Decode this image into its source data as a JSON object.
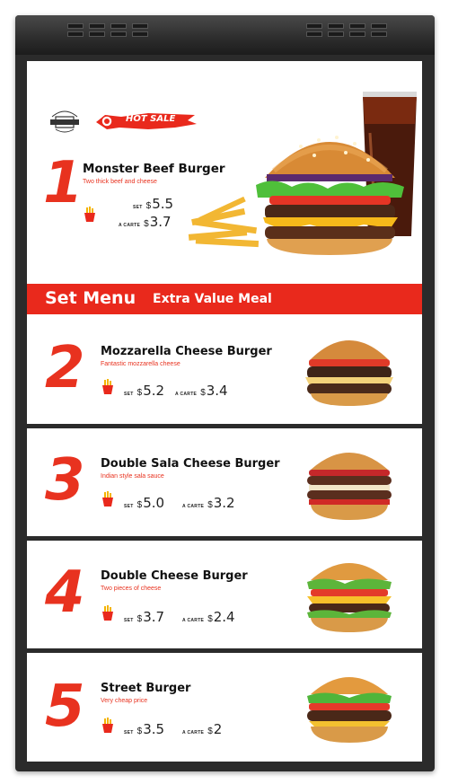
{
  "hero": {
    "badge": "HOT SALE",
    "number": "1",
    "title": "Monster Beef Burger",
    "subtitle": "Two thick beef and cheese",
    "set_label": "SET",
    "set_currency": "$",
    "set_price": "5.5",
    "carte_label": "A CARTE",
    "carte_currency": "$",
    "carte_price": "3.7"
  },
  "banner": {
    "title": "Set Menu",
    "subtitle": "Extra Value Meal"
  },
  "items": [
    {
      "number": "2",
      "title": "Mozzarella Cheese Burger",
      "subtitle": "Fantastic mozzarella cheese",
      "set_label": "SET",
      "currency": "$",
      "set_price": "5.2",
      "carte_label": "A CARTE",
      "carte_price": "3.4"
    },
    {
      "number": "3",
      "title": "Double Sala Cheese Burger",
      "subtitle": "Indian style sala sauce",
      "set_label": "SET",
      "currency": "$",
      "set_price": "5.0",
      "carte_label": "A CARTE",
      "carte_price": "3.2"
    },
    {
      "number": "4",
      "title": "Double Cheese Burger",
      "subtitle": "Two pieces of cheese",
      "set_label": "SET",
      "currency": "$",
      "set_price": "3.7",
      "carte_label": "A CARTE",
      "carte_price": "2.4"
    },
    {
      "number": "5",
      "title": "Street Burger",
      "subtitle": "Very cheap price",
      "set_label": "SET",
      "currency": "$",
      "set_price": "3.5",
      "carte_label": "A CARTE",
      "carte_price": "2"
    }
  ],
  "colors": {
    "accent": "#e8321f",
    "bezel": "#2b2b2b"
  },
  "icons": [
    "fries-icon",
    "burger-image",
    "soda-image",
    "shop-logo-icon",
    "hot-sale-splash-icon"
  ]
}
